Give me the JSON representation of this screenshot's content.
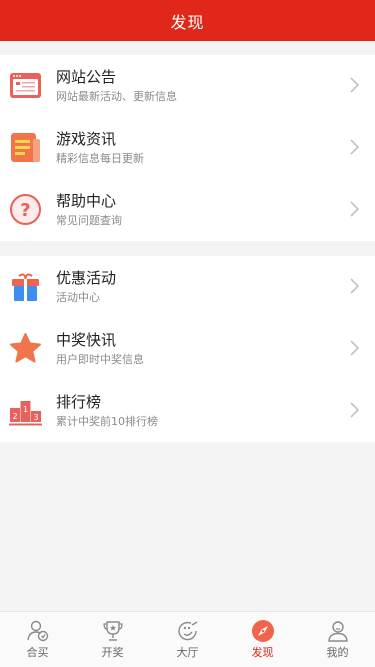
{
  "header": {
    "title": "发现"
  },
  "group1": [
    {
      "title": "网站公告",
      "sub": "网站最新活动、更新信息",
      "icon": "announcement-icon"
    },
    {
      "title": "游戏资讯",
      "sub": "精彩信息每日更新",
      "icon": "news-icon"
    },
    {
      "title": "帮助中心",
      "sub": "常见问题查询",
      "icon": "help-icon"
    }
  ],
  "group2": [
    {
      "title": "优惠活动",
      "sub": "活动中心",
      "icon": "gift-icon"
    },
    {
      "title": "中奖快讯",
      "sub": "用户即时中奖信息",
      "icon": "star-icon"
    },
    {
      "title": "排行榜",
      "sub": "累计中奖前10排行榜",
      "icon": "podium-icon"
    }
  ],
  "tabbar": {
    "tabs": [
      {
        "label": "合买",
        "icon": "group-buy-icon"
      },
      {
        "label": "开奖",
        "icon": "trophy-icon"
      },
      {
        "label": "大厅",
        "icon": "lobby-icon"
      },
      {
        "label": "发现",
        "icon": "compass-icon"
      },
      {
        "label": "我的",
        "icon": "profile-icon"
      }
    ],
    "active_index": 3
  },
  "colors": {
    "brand": "#e1261a",
    "background": "#f5f4f4"
  }
}
